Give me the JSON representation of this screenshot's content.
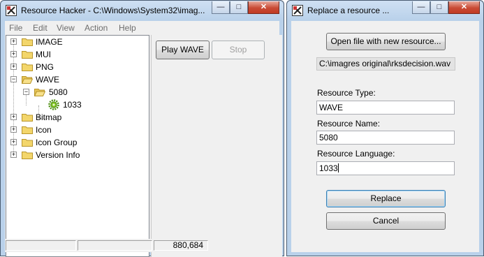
{
  "left_window": {
    "title": "Resource Hacker  -  C:\\Windows\\System32\\imag...",
    "caption": {
      "minimize": "—",
      "maximize": "□",
      "close": "✕"
    },
    "menu": [
      "File",
      "Edit",
      "View",
      "Action",
      "Help"
    ],
    "tree": [
      {
        "label": "IMAGE",
        "expander": "+"
      },
      {
        "label": "MUI",
        "expander": "+"
      },
      {
        "label": "PNG",
        "expander": "+"
      },
      {
        "label": "WAVE",
        "expander": "−"
      },
      {
        "label": "5080",
        "expander": "−"
      },
      {
        "label": "1033",
        "icon": "resource-gear-icon"
      },
      {
        "label": "Bitmap",
        "expander": "+"
      },
      {
        "label": "Icon",
        "expander": "+"
      },
      {
        "label": "Icon Group",
        "expander": "+"
      },
      {
        "label": "Version Info",
        "expander": "+"
      }
    ],
    "buttons": {
      "play": "Play WAVE",
      "stop": "Stop"
    },
    "status": {
      "cell1": "",
      "cell2": "",
      "position": "880,684"
    }
  },
  "right_window": {
    "title": "Replace a resource ...",
    "caption": {
      "minimize": "—",
      "maximize": "□",
      "close": "✕"
    },
    "open_button": "Open file with new resource...",
    "file_path": "C:\\imagres original\\rksdecision.wav",
    "type_label": "Resource Type:",
    "type_value": "WAVE",
    "name_label": "Resource Name:",
    "name_value": "5080",
    "lang_label": "Resource Language:",
    "lang_value": "1033",
    "replace_button": "Replace",
    "cancel_button": "Cancel"
  },
  "colors": {
    "title_bar": "#b9d1ea",
    "close_button": "#c94b35",
    "folder": "#f3d66b",
    "resource_gear": "#7cc020"
  }
}
